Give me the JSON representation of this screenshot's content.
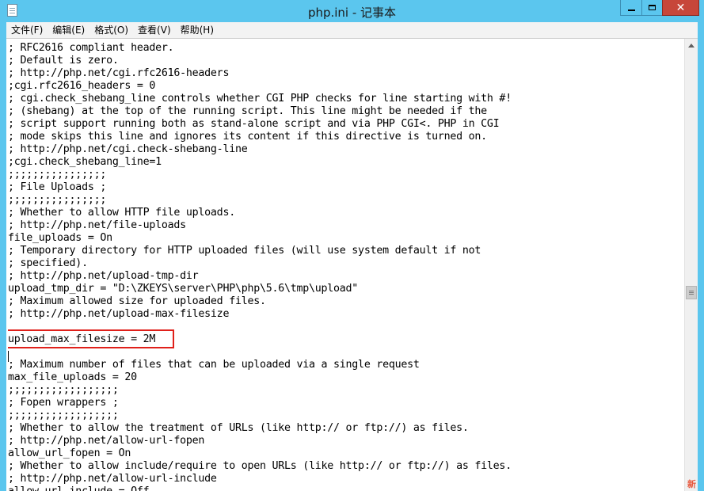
{
  "window": {
    "title": "php.ini - 记事本",
    "close_label": "✕"
  },
  "menu": [
    {
      "label": "文件(F)"
    },
    {
      "label": "编辑(E)"
    },
    {
      "label": "格式(O)"
    },
    {
      "label": "查看(V)"
    },
    {
      "label": "帮助(H)"
    }
  ],
  "editor": {
    "lines": [
      "; RFC2616 compliant header.",
      "; Default is zero.",
      "; http://php.net/cgi.rfc2616-headers",
      ";cgi.rfc2616_headers = 0",
      "; cgi.check_shebang_line controls whether CGI PHP checks for line starting with #!",
      "; (shebang) at the top of the running script. This line might be needed if the",
      "; script support running both as stand-alone script and via PHP CGI<. PHP in CGI",
      "; mode skips this line and ignores its content if this directive is turned on.",
      "; http://php.net/cgi.check-shebang-line",
      ";cgi.check_shebang_line=1",
      ";;;;;;;;;;;;;;;;",
      "; File Uploads ;",
      ";;;;;;;;;;;;;;;;",
      "; Whether to allow HTTP file uploads.",
      "; http://php.net/file-uploads",
      "file_uploads = On",
      "; Temporary directory for HTTP uploaded files (will use system default if not",
      "; specified).",
      "; http://php.net/upload-tmp-dir",
      "upload_tmp_dir = \"D:\\ZKEYS\\server\\PHP\\php\\5.6\\tmp\\upload\"",
      "; Maximum allowed size for uploaded files.",
      "; http://php.net/upload-max-filesize",
      "",
      "upload_max_filesize = 2M",
      "",
      "; Maximum number of files that can be uploaded via a single request",
      "max_file_uploads = 20",
      ";;;;;;;;;;;;;;;;;;",
      "; Fopen wrappers ;",
      ";;;;;;;;;;;;;;;;;;",
      "; Whether to allow the treatment of URLs (like http:// or ftp://) as files.",
      "; http://php.net/allow-url-fopen",
      "allow_url_fopen = On",
      "; Whether to allow include/require to open URLs (like http:// or ftp://) as files.",
      "; http://php.net/allow-url-include",
      "allow_url_include = Off"
    ]
  },
  "colors": {
    "titlebar": "#5bc6ee",
    "close_button": "#c7463a",
    "highlight": "#e0201a"
  },
  "corner_mark": "新"
}
